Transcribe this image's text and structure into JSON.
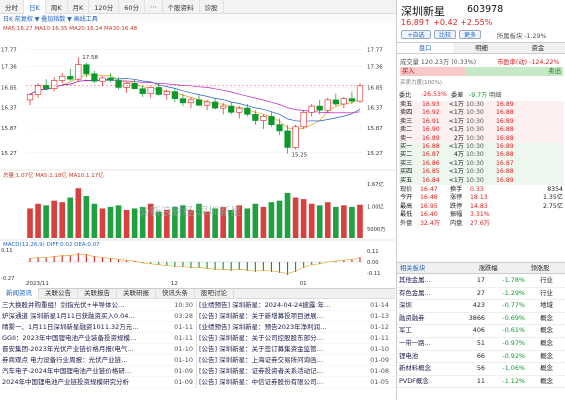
{
  "toolbar": {
    "tabs": [
      "分时",
      "日K",
      "周K",
      "月K",
      "120分",
      "60分",
      "⋯",
      "个股资料",
      "诊股"
    ]
  },
  "chart": {
    "legend_top": "日K 前复权 ▼ 叠加指数 ▼ 画线工具",
    "ma_line": "MA5:16.27  MA10:16.35  MA20:16.14  MA30:16.48",
    "price_ticks": [
      "17.77",
      "17.36",
      "16.85",
      "16.37",
      "15.87",
      "15.27"
    ],
    "max_label": "17.58",
    "min_label": "15.25",
    "vol_legend": "总量:1.07亿 MA5:1.18亿 MA10:1.17亿",
    "vol_ticks": [
      "1.67亿",
      "1.00亿",
      "5000万"
    ],
    "macd_legend": "MACD(12,26,9) DIFF:0.02 DEA:0.07",
    "macd_ticks": [
      "0.11",
      "0.00",
      "-0.11"
    ],
    "macd_left_top": "0.11",
    "macd_left_bottom": "-0.27",
    "x_labels": [
      "2023/11",
      "12",
      "01"
    ],
    "watermark": "@新浪财经·深圳新星"
  },
  "chart_data": {
    "type": "candlestick",
    "title": "深圳新星 603978 日K",
    "ylim": [
      15.0,
      17.9
    ],
    "max": 17.58,
    "min": 15.25,
    "ohlc": [
      [
        16.55,
        16.72,
        16.42,
        16.68
      ],
      [
        16.68,
        16.95,
        16.6,
        16.9
      ],
      [
        16.9,
        17.05,
        16.78,
        16.82
      ],
      [
        16.82,
        17.1,
        16.75,
        17.02
      ],
      [
        17.02,
        17.2,
        16.95,
        17.12
      ],
      [
        17.12,
        17.3,
        17.0,
        17.05
      ],
      [
        17.05,
        17.58,
        17.0,
        17.4
      ],
      [
        17.4,
        17.45,
        17.1,
        17.18
      ],
      [
        17.18,
        17.25,
        16.95,
        17.0
      ],
      [
        17.0,
        17.12,
        16.88,
        17.08
      ],
      [
        17.08,
        17.2,
        16.98,
        17.02
      ],
      [
        17.02,
        17.1,
        16.8,
        16.85
      ],
      [
        16.85,
        16.98,
        16.72,
        16.95
      ],
      [
        16.95,
        17.05,
        16.8,
        16.82
      ],
      [
        16.82,
        16.9,
        16.62,
        16.7
      ],
      [
        16.7,
        16.88,
        16.6,
        16.85
      ],
      [
        16.85,
        16.95,
        16.65,
        16.68
      ],
      [
        16.68,
        16.8,
        16.55,
        16.75
      ],
      [
        16.75,
        16.82,
        16.5,
        16.58
      ],
      [
        16.58,
        16.7,
        16.4,
        16.48
      ],
      [
        16.48,
        16.62,
        16.35,
        16.55
      ],
      [
        16.55,
        16.66,
        16.4,
        16.42
      ],
      [
        16.42,
        16.55,
        16.3,
        16.5
      ],
      [
        16.5,
        16.6,
        16.32,
        16.35
      ],
      [
        16.35,
        16.48,
        16.2,
        16.4
      ],
      [
        16.4,
        16.5,
        16.2,
        16.25
      ],
      [
        16.25,
        16.4,
        16.1,
        16.35
      ],
      [
        16.35,
        16.45,
        16.15,
        16.2
      ],
      [
        16.2,
        16.3,
        15.95,
        16.05
      ],
      [
        16.05,
        16.2,
        15.85,
        16.15
      ],
      [
        16.15,
        16.25,
        15.9,
        15.95
      ],
      [
        15.95,
        16.1,
        15.7,
        15.8
      ],
      [
        15.8,
        15.95,
        15.25,
        15.4
      ],
      [
        15.4,
        15.95,
        15.35,
        15.9
      ],
      [
        15.9,
        16.3,
        15.85,
        16.25
      ],
      [
        16.25,
        16.45,
        16.15,
        16.4
      ],
      [
        16.4,
        16.55,
        16.2,
        16.3
      ],
      [
        16.3,
        16.6,
        16.25,
        16.55
      ],
      [
        16.55,
        16.7,
        16.4,
        16.45
      ],
      [
        16.45,
        16.62,
        16.35,
        16.58
      ],
      [
        16.58,
        16.75,
        16.45,
        16.52
      ],
      [
        16.52,
        16.95,
        16.48,
        16.89
      ]
    ],
    "volume": [
      0.95,
      1.1,
      1.05,
      1.2,
      1.15,
      1.3,
      1.6,
      1.35,
      1.1,
      0.95,
      1.0,
      1.05,
      0.9,
      0.95,
      1.0,
      1.1,
      0.85,
      0.9,
      1.0,
      1.05,
      0.9,
      1.1,
      0.85,
      0.95,
      1.0,
      0.9,
      1.05,
      0.95,
      1.1,
      1.0,
      1.15,
      1.2,
      1.45,
      1.3,
      1.25,
      1.1,
      1.05,
      1.15,
      1.0,
      1.05,
      1.0,
      1.07
    ],
    "macd": [
      0.04,
      0.05,
      0.05,
      0.06,
      0.07,
      0.07,
      0.09,
      0.08,
      0.06,
      0.05,
      0.04,
      0.03,
      0.02,
      0.01,
      -0.01,
      -0.02,
      -0.03,
      -0.04,
      -0.05,
      -0.05,
      -0.06,
      -0.06,
      -0.07,
      -0.08,
      -0.08,
      -0.09,
      -0.08,
      -0.09,
      -0.1,
      -0.09,
      -0.1,
      -0.11,
      -0.13,
      -0.1,
      -0.06,
      -0.03,
      -0.02,
      0.0,
      0.01,
      0.02,
      0.03,
      0.05
    ]
  },
  "news_tabs": [
    "新闻资讯",
    "关联公告",
    "关联报告",
    "关联研报",
    "快讯头条",
    "股吧讨论"
  ],
  "news_left": [
    {
      "title": "三大换股并购重组！剑指光伏+半导体公…",
      "time": "10:30"
    },
    {
      "title": "炉深通道 深圳新星1月11日获融资买入0.04…",
      "time": "03:28"
    },
    {
      "title": "晴雾一、1月11日深圳新星融资1011.32万元…",
      "time": "01-11"
    },
    {
      "title": "GGII：2023年中国锂电池产业装备投资规模…",
      "time": "01-11"
    },
    {
      "title": "晋安集团-2023年光伏产业链价格月报(电气…",
      "time": "01-10"
    },
    {
      "title": "券商观点 电力设备行业周报：光伏产业链…",
      "time": "01-10"
    },
    {
      "title": "汽车电子-2024年中国锂电池产业链价格研…",
      "time": "01-09"
    },
    {
      "title": "2024年中国锂电池产业链投资规模研究分析",
      "time": "01-09"
    }
  ],
  "news_right": [
    {
      "title": "[业绩预告] 深圳新星：2024-04-24披露 年…",
      "time": "01-14"
    },
    {
      "title": "[公告] 深圳新星：关于新增募投项目进展…",
      "time": "01-13"
    },
    {
      "title": "[业绩预告] 深圳新星：预告2023年净利润…",
      "time": "01-12"
    },
    {
      "title": "[公告] 深圳新星：关于公司控股股东部分…",
      "time": "01-11"
    },
    {
      "title": "[公告] 深圳新星：关于签订募集资金监管…",
      "time": "01-10"
    },
    {
      "title": "[公告] 深圳新星：上海证券交易所问询函…",
      "time": "01-09"
    },
    {
      "title": "[公告] 深圳新星：证券投资者关系活动记…",
      "time": "01-08"
    },
    {
      "title": "[公告] 深圳新星：中信证券股份有限公司…",
      "time": "01-05"
    }
  ],
  "stock": {
    "name": "深圳新星",
    "code": "603978",
    "price_line": "16.89↑ +0.42 +2.55%",
    "btn_watch": "+自选",
    "btn_compare": "比较",
    "btn_more": "更多",
    "sector_line": "所属板块 -1.29%",
    "row_tabs": [
      "盘口",
      "明细",
      "资金"
    ],
    "meta1": "成交量 120.23万 (0.33%)",
    "meta2": "市盈率(动) -124.22%",
    "buy_label": "买入",
    "sell_label": "卖出",
    "bar_note": "买卖力度(100%)",
    "ratio_label": "委比",
    "ratio": "-26.53%",
    "diff_label": "委差",
    "diff": "-9.7万",
    "sells": [
      {
        "l": "卖五",
        "p": "16.93",
        "v": "<1万"
      },
      {
        "l": "卖四",
        "p": "16.92",
        "v": "<1万"
      },
      {
        "l": "卖三",
        "p": "16.91",
        "v": "<1万"
      },
      {
        "l": "卖二",
        "p": "16.90",
        "v": "<1万"
      },
      {
        "l": "卖一",
        "p": "16.89",
        "v": "2万"
      }
    ],
    "buys": [
      {
        "l": "买一",
        "p": "16.88",
        "v": "<1万"
      },
      {
        "l": "买二",
        "p": "16.87",
        "v": "4万"
      },
      {
        "l": "买三",
        "p": "16.86",
        "v": "<1万"
      },
      {
        "l": "买四",
        "p": "16.85",
        "v": "<1万"
      },
      {
        "l": "买五",
        "p": "16.84",
        "v": "<1万"
      }
    ],
    "right_col_title": "明细",
    "ticks": [
      {
        "t": "10:30",
        "p": "16.89"
      },
      {
        "t": "10:30",
        "p": "16.88"
      },
      {
        "t": "10:30",
        "p": "16.89"
      },
      {
        "t": "10:30",
        "p": "16.88"
      },
      {
        "t": "10:30",
        "p": "16.88"
      },
      {
        "t": "10:30",
        "p": "16.89"
      },
      {
        "t": "10:30",
        "p": "16.88"
      },
      {
        "t": "10:30",
        "p": "16.87"
      },
      {
        "t": "10:30",
        "p": "16.88"
      },
      {
        "t": "10:30",
        "p": "16.89"
      },
      {
        "t": "10:30",
        "p": "16.88"
      }
    ],
    "stats": [
      [
        "现价",
        "16.47",
        "换手",
        "0.33"
      ],
      [
        "今开",
        "16.48",
        "涨停",
        "18.13"
      ],
      [
        "最高",
        "16.95",
        "跌停",
        "14.83"
      ],
      [
        "最低",
        "16.40",
        "振幅",
        "3.31%"
      ],
      [
        "外盘",
        "32.4万",
        "内盘",
        "27.6万"
      ]
    ],
    "stats_extra": [
      "8354",
      "1.35亿",
      "2.75亿"
    ],
    "related_tabs": [
      "相关板块",
      "涨跌幅",
      "领涨股"
    ],
    "related": [
      {
        "name": "其他金属…",
        "a": "17",
        "pct": "-1.78%",
        "tag": "行业"
      },
      {
        "name": "有色金属…",
        "a": "27",
        "pct": "-1.29%",
        "tag": "行业"
      },
      {
        "name": "深圳",
        "a": "423",
        "pct": "-0.77%",
        "tag": "地域"
      },
      {
        "name": "融资融券",
        "a": "3866",
        "pct": "-0.69%",
        "tag": "概念"
      },
      {
        "name": "军工",
        "a": "406",
        "pct": "-0.61%",
        "tag": "概念"
      },
      {
        "name": "一带一路…",
        "a": "51",
        "pct": "-0.97%",
        "tag": "概念"
      },
      {
        "name": "锂电池",
        "a": "66",
        "pct": "-0.92%",
        "tag": "概念"
      },
      {
        "name": "新材料概念",
        "a": "56",
        "pct": "-1.06%",
        "tag": "概念"
      },
      {
        "name": "PVDF概念",
        "a": "11",
        "pct": "-1.12%",
        "tag": "概念"
      }
    ]
  },
  "colors": {
    "up": "#e02020",
    "down": "#0a9a2a",
    "ma5": "#e0a020",
    "ma10": "#2060c0",
    "ma20": "#c020c0",
    "accent": "#1f64c8"
  }
}
